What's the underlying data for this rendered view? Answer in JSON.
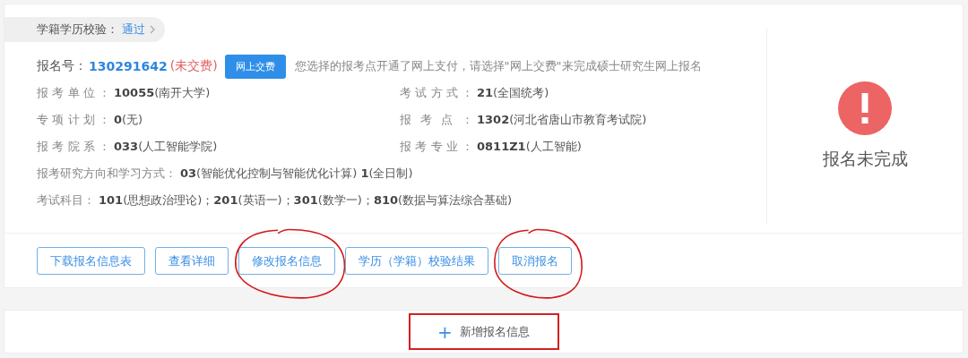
{
  "verification": {
    "label": "学籍学历校验：",
    "value": "通过"
  },
  "registration": {
    "label": "报名号：",
    "number": "130291642",
    "status": "(未交费)",
    "unpaid": true,
    "pay_button": "网上交费",
    "notice": "您选择的报考点开通了网上支付，请选择\"网上交费\"来完成硕士研究生网上报名"
  },
  "fields": [
    {
      "kind": "pair",
      "label": "报考单位：",
      "value": "**10055**(南开大学)"
    },
    {
      "kind": "pair",
      "label": "考试方式：",
      "value": "**21**(全国统考)"
    },
    {
      "kind": "pair",
      "label": "专项计划：",
      "value": "**0**(无)"
    },
    {
      "kind": "pair",
      "label": "报考点：",
      "value": "**1302**(河北省唐山市教育考试院)"
    },
    {
      "kind": "pair",
      "label": "报考院系：",
      "value": "**033**(人工智能学院)"
    },
    {
      "kind": "pair",
      "label": "报考专业：",
      "value": "**0811Z1**(人工智能)"
    },
    {
      "kind": "wide",
      "label": "报考研究方向和学习方式：",
      "value": "**03**(智能优化控制与智能优化计算) **1**(全日制)"
    },
    {
      "kind": "wide",
      "label": "考试科目：",
      "value": "**101**(思想政治理论)；**201**(英语一)；**301**(数学一)；**810**(数据与算法综合基础)"
    }
  ],
  "status_panel": {
    "kind": "warning",
    "text": "报名未完成"
  },
  "actions": [
    {
      "label": "下载报名信息表",
      "circled": false
    },
    {
      "label": "查看详细",
      "circled": false
    },
    {
      "label": "修改报名信息",
      "circled": true
    },
    {
      "label": "学历（学籍）校验结果",
      "circled": false
    },
    {
      "label": "取消报名",
      "circled": true
    }
  ],
  "add_button": {
    "icon": "+",
    "label": "新增报名信息",
    "boxed": true
  }
}
